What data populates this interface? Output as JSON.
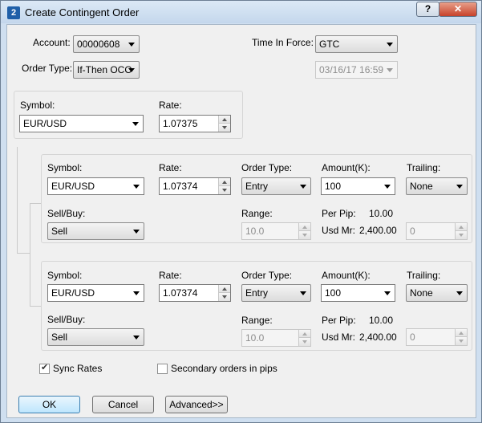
{
  "window": {
    "title": "Create Contingent Order",
    "help_label": "?",
    "close_label": "✕"
  },
  "main": {
    "account_label": "Account:",
    "account_value": "00000608",
    "order_type_label": "Order Type:",
    "order_type_value": "If-Then OCO",
    "tif_label": "Time In Force:",
    "tif_value": "GTC",
    "expiry_value": "03/16/17 16:59"
  },
  "primary": {
    "symbol_label": "Symbol:",
    "symbol_value": "EUR/USD",
    "rate_label": "Rate:",
    "rate_value": "1.07375"
  },
  "orders": [
    {
      "symbol_label": "Symbol:",
      "symbol_value": "EUR/USD",
      "rate_label": "Rate:",
      "rate_value": "1.07374",
      "order_type_label": "Order Type:",
      "order_type_value": "Entry",
      "amount_label": "Amount(K):",
      "amount_value": "100",
      "trailing_label": "Trailing:",
      "trailing_value": "None",
      "sellbuy_label": "Sell/Buy:",
      "sellbuy_value": "Sell",
      "range_label": "Range:",
      "range_value": "10.0",
      "per_pip_label": "Per Pip:",
      "per_pip_value": "10.00",
      "usd_mr_label": "Usd Mr:",
      "usd_mr_value": "2,400.00",
      "trailing_pips_value": "0"
    },
    {
      "symbol_label": "Symbol:",
      "symbol_value": "EUR/USD",
      "rate_label": "Rate:",
      "rate_value": "1.07374",
      "order_type_label": "Order Type:",
      "order_type_value": "Entry",
      "amount_label": "Amount(K):",
      "amount_value": "100",
      "trailing_label": "Trailing:",
      "trailing_value": "None",
      "sellbuy_label": "Sell/Buy:",
      "sellbuy_value": "Sell",
      "range_label": "Range:",
      "range_value": "10.0",
      "per_pip_label": "Per Pip:",
      "per_pip_value": "10.00",
      "usd_mr_label": "Usd Mr:",
      "usd_mr_value": "2,400.00",
      "trailing_pips_value": "0"
    }
  ],
  "options": {
    "sync_rates_label": "Sync Rates",
    "sync_rates_checked": true,
    "secondary_pips_label": "Secondary orders in pips",
    "secondary_pips_checked": false
  },
  "buttons": {
    "ok": "OK",
    "cancel": "Cancel",
    "advanced": "Advanced>>"
  }
}
